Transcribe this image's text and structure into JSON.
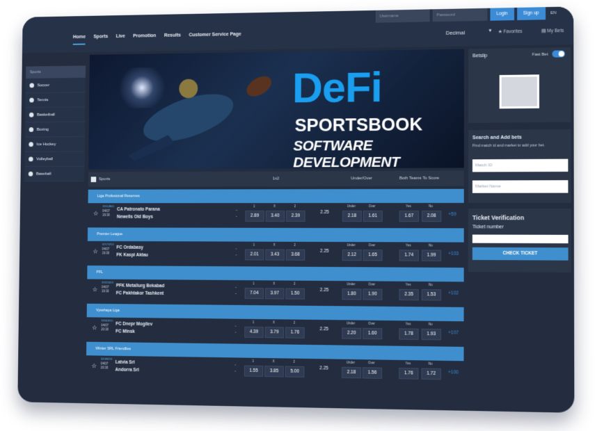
{
  "header": {
    "nav": [
      "Home",
      "Sports",
      "Live",
      "Promotion",
      "Results",
      "Customer Service Page"
    ],
    "username_placeholder": "Username",
    "password_placeholder": "Password",
    "login_label": "Login",
    "signup_label": "Sign up",
    "lang": "EN",
    "odds_format": "Decimal",
    "favorites": "Favorites",
    "mybets": "My Bets"
  },
  "sidebar": {
    "title": "Sports",
    "items": [
      "Soccer",
      "Tennis",
      "Basketball",
      "Boxing",
      "Ice Hockey",
      "Volleyball",
      "Baseball"
    ]
  },
  "banner": {
    "line1": "DeFi",
    "line2": "SPORTSBOOK",
    "line3": "SOFTWARE DEVELOPMENT"
  },
  "table": {
    "head": [
      "Sports",
      "1x2",
      "Under/Over",
      "Both Teams To Score"
    ],
    "odds_labels": [
      "1",
      "X",
      "2",
      "Under",
      "Over",
      "Yes",
      "No"
    ],
    "leagues": [
      {
        "name": "Liga Profesional Reserves",
        "id": "33514865",
        "date": "04/07",
        "time": "19:30",
        "home": "CA Patronato Parana",
        "away": "Newells Old Boys",
        "odds": [
          "2.89",
          "3.40",
          "2.39"
        ],
        "line": "2.25",
        "uo": [
          "2.18",
          "1.61"
        ],
        "btts": [
          "1.67",
          "2.08"
        ],
        "more": "+59"
      },
      {
        "name": "Premier League",
        "id": "32571253",
        "date": "04/07",
        "time": "19:30",
        "home": "FC Ordabasy",
        "away": "FK Kaspi Aktau",
        "odds": [
          "2.01",
          "3.43",
          "3.68"
        ],
        "line": "2.25",
        "uo": [
          "2.12",
          "1.65"
        ],
        "btts": [
          "1.74",
          "1.99"
        ],
        "more": "+103"
      },
      {
        "name": "PFL",
        "id": "33321453",
        "date": "04/07",
        "time": "19:30",
        "home": "PFK Metallurg Bekabad",
        "away": "FC Pakhtakor Tashkent",
        "odds": [
          "7.04",
          "3.97",
          "1.50"
        ],
        "line": "2.25",
        "uo": [
          "1.80",
          "1.90"
        ],
        "btts": [
          "2.35",
          "1.53"
        ],
        "more": "+102"
      },
      {
        "name": "Vysshaya Liga",
        "id": "33961915",
        "date": "04/07",
        "time": "20:30",
        "home": "FC Dnepr Mogilev",
        "away": "FC Minsk",
        "odds": [
          "4.39",
          "3.79",
          "1.76"
        ],
        "line": "2.25",
        "uo": [
          "2.20",
          "1.60"
        ],
        "btts": [
          "1.78",
          "1.93"
        ],
        "more": "+107"
      },
      {
        "name": "Winter SRL Friendlies",
        "id": "34586231",
        "date": "04/07",
        "time": "20:30",
        "home": "Latvia Srl",
        "away": "Andorra Srl",
        "odds": [
          "1.55",
          "3.85",
          "5.00"
        ],
        "line": "2.25",
        "uo": [
          "2.18",
          "1.56"
        ],
        "btts": [
          "1.76",
          "1.72"
        ],
        "more": "+100"
      }
    ]
  },
  "betslip": {
    "title": "Betslip",
    "fast_bet": "Fast Bet"
  },
  "search": {
    "title": "Search and Add bets",
    "subtitle": "Find match id and market to add your bet.",
    "match_id_placeholder": "Match ID",
    "market_placeholder": "Market Name"
  },
  "verify": {
    "title": "Ticket Verification",
    "subtitle": "Ticket number",
    "button": "CHECK TICKET"
  }
}
